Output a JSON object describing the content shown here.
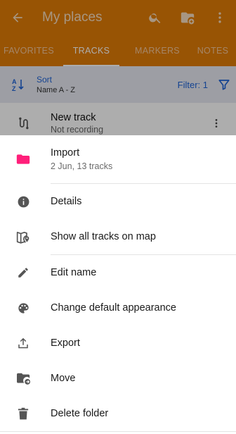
{
  "appbar": {
    "title": "My places"
  },
  "tabs": [
    {
      "label": "FAVORITES",
      "active": false
    },
    {
      "label": "TRACKS",
      "active": true
    },
    {
      "label": "MARKERS",
      "active": false
    },
    {
      "label": "NOTES",
      "active": false
    }
  ],
  "sort": {
    "label": "Sort",
    "value": "Name A - Z",
    "filter": "Filter: 1"
  },
  "track": {
    "name": "New track",
    "status": "Not recording"
  },
  "sheet": {
    "header": {
      "label": "Import",
      "subtitle": "2 Jun, 13 tracks"
    },
    "items": [
      {
        "label": "Details",
        "icon": "info-icon"
      },
      {
        "label": "Show all tracks on map",
        "icon": "map-pin-icon"
      },
      {
        "label": "Edit name",
        "icon": "pencil-icon"
      },
      {
        "label": "Change default appearance",
        "icon": "palette-icon"
      },
      {
        "label": "Export",
        "icon": "upload-icon"
      },
      {
        "label": "Move",
        "icon": "folder-move-icon"
      },
      {
        "label": "Delete folder",
        "icon": "trash-icon"
      }
    ]
  },
  "colors": {
    "appbar": "#e07c06",
    "accent": "#1e63d6",
    "folder": "#ff1f7a",
    "icon": "#555555"
  }
}
